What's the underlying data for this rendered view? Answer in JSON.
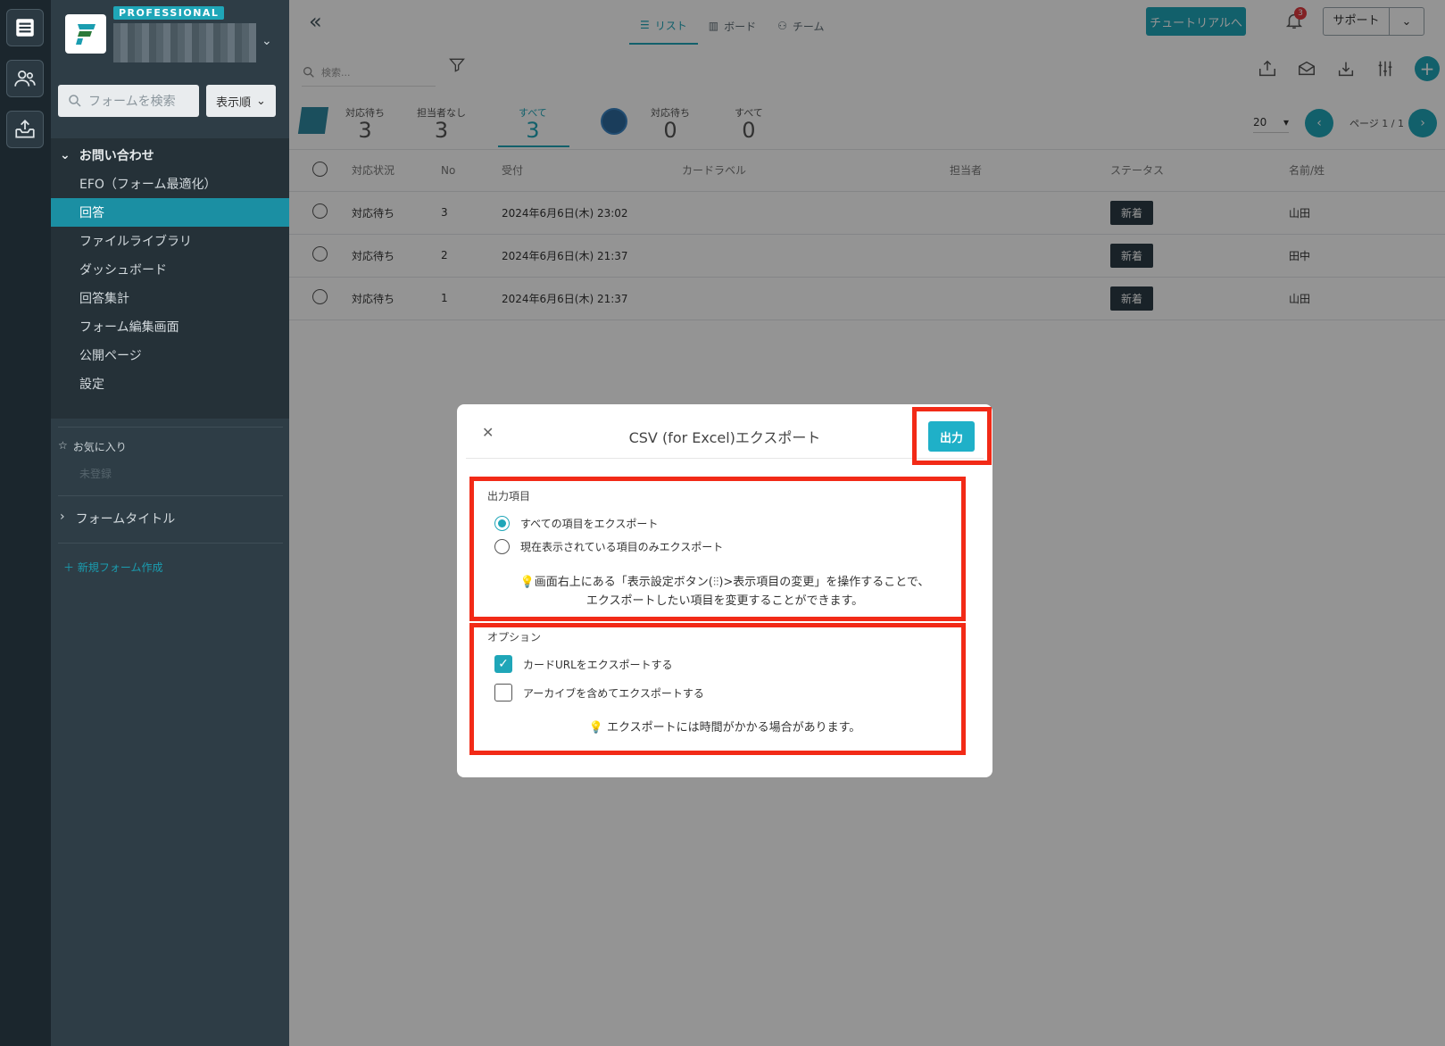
{
  "rail": {
    "icons": [
      "form-list-icon",
      "users-icon",
      "inbox-export-icon"
    ]
  },
  "sidebar": {
    "badge": "PROFESSIONAL",
    "search_placeholder": "フォームを検索",
    "sort_label": "表示順",
    "group_label": "お問い合わせ",
    "items": [
      {
        "label": "EFO（フォーム最適化）"
      },
      {
        "label": "回答"
      },
      {
        "label": "ファイルライブラリ"
      },
      {
        "label": "ダッシュボード"
      },
      {
        "label": "回答集計"
      },
      {
        "label": "フォーム編集画面"
      },
      {
        "label": "公開ページ"
      },
      {
        "label": "設定"
      }
    ],
    "favorites_label": "お気に入り",
    "favorites_empty": "未登録",
    "form_title": "フォームタイトル",
    "new_form": "新規フォーム作成"
  },
  "topbar": {
    "views": [
      {
        "label": "リスト",
        "icon": "list-icon"
      },
      {
        "label": "ボード",
        "icon": "board-icon"
      },
      {
        "label": "チーム",
        "icon": "team-icon"
      }
    ],
    "tutorial": "チュートリアルへ",
    "notification_count": "3",
    "support": "サポート"
  },
  "search": {
    "placeholder": "検索..."
  },
  "stats": {
    "s1": {
      "caption": "対応待ち",
      "value": "3"
    },
    "s2": {
      "caption": "担当者なし",
      "value": "3"
    },
    "s3": {
      "caption": "すべて",
      "value": "3"
    },
    "s4": {
      "caption": "対応待ち",
      "value": "0"
    },
    "s5": {
      "caption": "すべて",
      "value": "0"
    }
  },
  "pagination": {
    "per_page": "20",
    "page_label": "ページ 1 / 1"
  },
  "table": {
    "headers": {
      "status": "対応状況",
      "no": "No",
      "received": "受付",
      "card_label": "カードラベル",
      "assignee": "担当者",
      "state": "ステータス",
      "name": "名前/姓"
    },
    "rows": [
      {
        "status": "対応待ち",
        "no": "3",
        "received": "2024年6月6日(木) 23:02",
        "state": "新着",
        "name": "山田"
      },
      {
        "status": "対応待ち",
        "no": "2",
        "received": "2024年6月6日(木) 21:37",
        "state": "新着",
        "name": "田中"
      },
      {
        "status": "対応待ち",
        "no": "1",
        "received": "2024年6月6日(木) 21:37",
        "state": "新着",
        "name": "山田"
      }
    ]
  },
  "modal": {
    "title": "CSV (for Excel)エクスポート",
    "output_button": "出力",
    "section_items": "出力項目",
    "opt_all": "すべての項目をエクスポート",
    "opt_visible": "現在表示されている項目のみエクスポート",
    "hint1_line1": "画面右上にある「表示設定ボタン(⫶⫶)>表示項目の変更」を操作することで、",
    "hint1_line2": "エクスポートしたい項目を変更することができます。",
    "section_options": "オプション",
    "cb_card_url": "カードURLをエクスポートする",
    "cb_archive": "アーカイブを含めてエクスポートする",
    "hint2": "エクスポートには時間がかかる場合があります。"
  },
  "colors": {
    "accent": "#1fa6b8",
    "highlight": "#f22a17",
    "sidebar": "#2e3d46"
  }
}
